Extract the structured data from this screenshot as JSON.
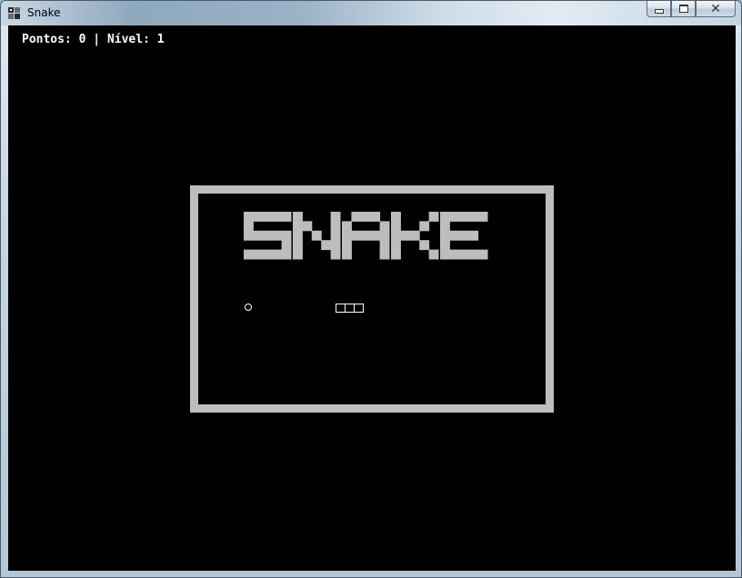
{
  "window": {
    "title": "Snake",
    "icon": "app-icon",
    "controls": {
      "minimize": "minimize-icon",
      "maximize": "maximize-icon",
      "close": "close-icon"
    }
  },
  "hud": {
    "points_label": "Pontos:",
    "points": 0,
    "separator": "|",
    "level_label": "Nível:",
    "level": 1
  },
  "splash": {
    "logo_text": "SNAKE",
    "food_symbol": "circle",
    "snake_length": 3
  },
  "colors": {
    "background": "#000000",
    "frame": "#bdbdbd",
    "logo": "#bdbdbd",
    "hud_text": "#ffffff",
    "sprite": "#ffffff"
  }
}
